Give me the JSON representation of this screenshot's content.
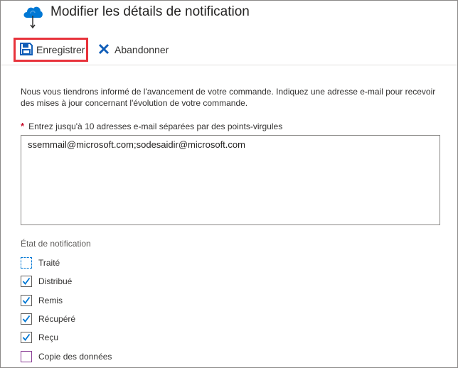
{
  "window": {
    "title": "Modifier les détails de notification",
    "icon": "cloud-upload-icon"
  },
  "toolbar": {
    "save_label": "Enregistrer",
    "discard_label": "Abandonner"
  },
  "form": {
    "description": "Nous vous tiendrons informé de l'avancement de votre commande. Indiquez une adresse e-mail pour recevoir des mises à jour concernant l'évolution de votre commande.",
    "required_marker": "*",
    "email_label": "Entrez jusqu'à 10 adresses e-mail séparées par des points-virgules",
    "email_value": "ssemmail@microsoft.com;sodesaidir@microsoft.com"
  },
  "notification": {
    "section_title": "État de notification",
    "options": [
      {
        "label": "Traité",
        "checked": false
      },
      {
        "label": "Distribué",
        "checked": true
      },
      {
        "label": "Remis",
        "checked": true
      },
      {
        "label": "Récupéré",
        "checked": true
      },
      {
        "label": "Reçu",
        "checked": true
      },
      {
        "label": "Copie des données",
        "checked": false
      }
    ]
  },
  "colors": {
    "accent": "#0078d4",
    "highlight": "#e8333b",
    "purple": "#8b3f96"
  }
}
